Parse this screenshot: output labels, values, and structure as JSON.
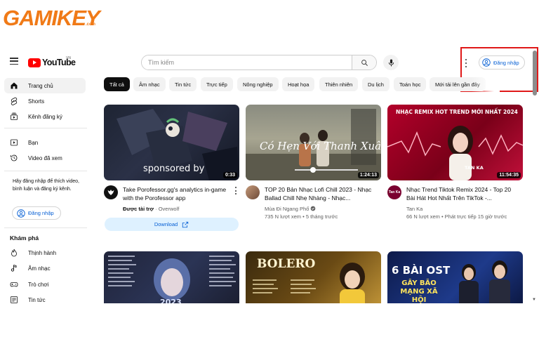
{
  "watermark": {
    "text": "GAMIKEY",
    "sub": ".com"
  },
  "header": {
    "logo_word": "YouTube",
    "country_code": "VN",
    "search_placeholder": "Tìm kiếm",
    "signin_label": "Đăng nhập"
  },
  "sidebar": {
    "items": [
      {
        "label": "Trang chủ",
        "icon": "home-icon",
        "active": true
      },
      {
        "label": "Shorts",
        "icon": "shorts-icon"
      },
      {
        "label": "Kênh đăng ký",
        "icon": "subscriptions-icon"
      },
      {
        "label": "Bạn",
        "icon": "you-icon"
      },
      {
        "label": "Video đã xem",
        "icon": "history-icon"
      }
    ],
    "signin_message": "Hãy đăng nhập để thích video, bình luận và đăng ký kênh.",
    "signin_label": "Đăng nhập",
    "explore_heading": "Khám phá",
    "explore_items": [
      {
        "label": "Thịnh hành",
        "icon": "trending-icon"
      },
      {
        "label": "Âm nhạc",
        "icon": "music-icon"
      },
      {
        "label": "Trò chơi",
        "icon": "gaming-icon"
      },
      {
        "label": "Tin tức",
        "icon": "news-icon"
      }
    ]
  },
  "chips": [
    {
      "label": "Tất cả",
      "active": true
    },
    {
      "label": "Âm nhạc"
    },
    {
      "label": "Tin tức"
    },
    {
      "label": "Trực tiếp"
    },
    {
      "label": "Nông nghiệp"
    },
    {
      "label": "Hoạt họa"
    },
    {
      "label": "Thiên nhiên"
    },
    {
      "label": "Du lịch"
    },
    {
      "label": "Toán học"
    },
    {
      "label": "Mới tải lên gần đây"
    }
  ],
  "videos": [
    {
      "title": "Take Porofessor.gg's analytics in-game with the Porofessor app",
      "ad_label": "Được tài trợ",
      "channel": "Overwolf",
      "duration": "0:33",
      "thumb_text": "sponsored by",
      "download_label": "Download"
    },
    {
      "title": "TOP 20 Bản Nhạc Lofi Chill 2023 - Nhạc Ballad Chill Nhẹ Nhàng - Nhạc...",
      "channel": "Mùa Đi Ngang Phố",
      "meta": "735 N lượt xem • 5 tháng trước",
      "duration": "1:24:13",
      "thumb_text": "Có Hẹn Với Thanh Xuân"
    },
    {
      "title": "Nhạc Trend Tiktok Remix 2024 - Top 20 Bài Hát Hot Nhất Trên TikTok -...",
      "channel": "Tan Ka",
      "meta": "66 N lượt xem • Phát trực tiếp 15 giờ trước",
      "duration": "11:54:35",
      "thumb_text": "NHẠC REMIX HOT TREND MỚI NHẤT 2024",
      "thumb_tag": "TAN KA"
    }
  ],
  "row2": [
    {
      "thumb_text": "2023"
    },
    {
      "thumb_text": "BOLERO"
    },
    {
      "thumb_text": "6 BÀI OST",
      "thumb_sub": "GÂY BÃO MẠNG XÃ HỘI"
    }
  ],
  "colors": {
    "brand_red": "#ff0000",
    "link_blue": "#065fd4",
    "highlight_box": "#e01818"
  }
}
